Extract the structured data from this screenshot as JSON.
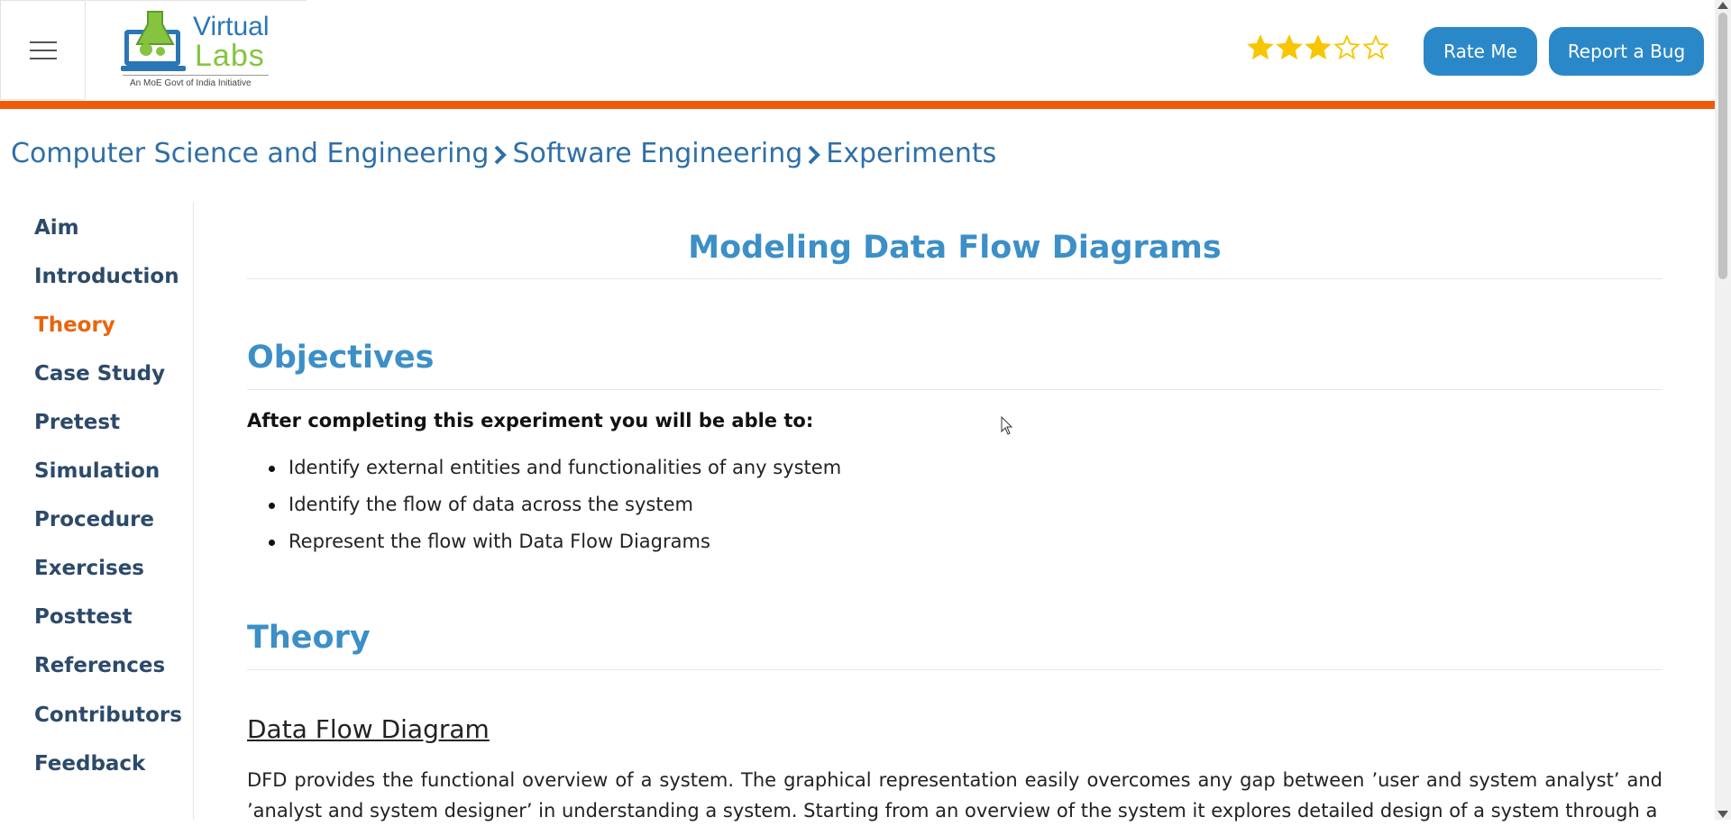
{
  "header": {
    "logo": {
      "line1": "Virtual",
      "line2": "Labs",
      "tagline": "An MoE Govt of India Initiative"
    },
    "rating": {
      "value": 3,
      "max": 5,
      "color": "#f7c600"
    },
    "rate_button": "Rate Me",
    "report_button": "Report a Bug",
    "accent_color": "#f05a0c",
    "button_color": "#2b88c8"
  },
  "breadcrumb": {
    "items": [
      "Computer Science and Engineering",
      "Software Engineering",
      "Experiments"
    ]
  },
  "sidebar": {
    "items": [
      {
        "label": "Aim"
      },
      {
        "label": "Introduction"
      },
      {
        "label": "Theory",
        "active": true
      },
      {
        "label": "Case Study"
      },
      {
        "label": "Pretest"
      },
      {
        "label": "Simulation"
      },
      {
        "label": "Procedure"
      },
      {
        "label": "Exercises"
      },
      {
        "label": "Posttest"
      },
      {
        "label": "References"
      },
      {
        "label": "Contributors"
      },
      {
        "label": "Feedback"
      }
    ]
  },
  "main": {
    "title": "Modeling Data Flow Diagrams",
    "objectives": {
      "heading": "Objectives",
      "lead": "After completing this experiment you will be able to:",
      "bullets": [
        "Identify external entities and functionalities of any system",
        "Identify the flow of data across the system",
        "Represent the flow with Data Flow Diagrams"
      ]
    },
    "theory": {
      "heading": "Theory",
      "subheading": "Data Flow Diagram",
      "paragraph": "DFD provides the functional overview of a system. The graphical representation easily overcomes any gap between ’user and system analyst’ and ’analyst and system designer’ in understanding a system. Starting from an overview of the system it explores detailed design of a system through a"
    }
  }
}
